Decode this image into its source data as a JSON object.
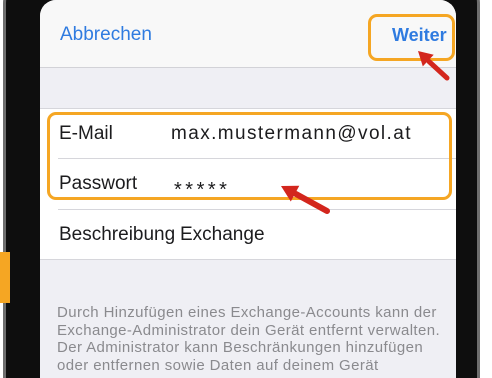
{
  "nav": {
    "cancel_label": "Abbrechen",
    "next_label": "Weiter"
  },
  "form": {
    "email": {
      "label": "E-Mail",
      "value": "max.mustermann@vol.at"
    },
    "password": {
      "label": "Passwort",
      "value": "*****"
    },
    "description": {
      "label": "Beschreibung",
      "value": "Exchange"
    }
  },
  "footer": {
    "lines": [
      "Durch Hinzufügen eines Exchange-Accounts kann der",
      "Exchange-Administrator dein Gerät entfernt verwalten.",
      "Der Administrator kann Beschränkungen hinzufügen",
      "oder entfernen sowie Daten auf deinem Gerät"
    ]
  },
  "colors": {
    "accent": "#2f7be0",
    "highlight": "#f5a623",
    "arrow": "#d3261d"
  }
}
